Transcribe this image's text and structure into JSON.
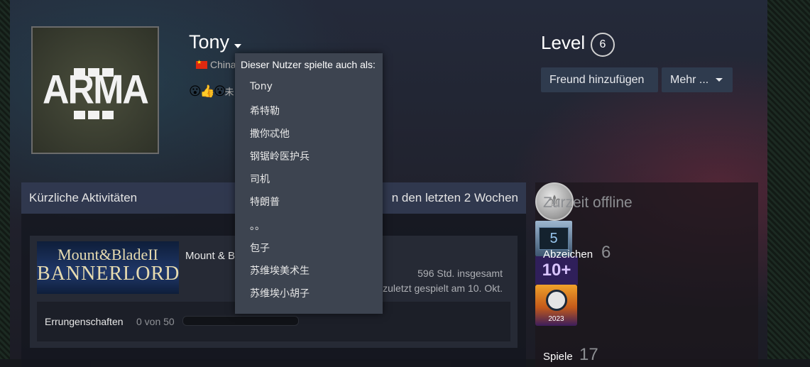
{
  "profile": {
    "persona_name": "Tony",
    "location": "China",
    "avatar_logo_text": "ARMA",
    "emoticon_tail": "未"
  },
  "level": {
    "label": "Level",
    "value": "6"
  },
  "actions": {
    "add_friend": "Freund hinzufügen",
    "more": "Mehr ..."
  },
  "alias_menu": {
    "header": "Dieser Nutzer spielte auch als:",
    "aliases": [
      "Tony",
      "希特勒",
      "撒你忒他",
      "钢锯岭医护兵",
      "司机",
      "特朗普",
      "。。",
      "包子",
      "苏维埃美术生",
      "苏维埃小胡子"
    ]
  },
  "activity": {
    "title": "Kürzliche Aktivitäten",
    "hours_recent_partial": "n den letzten 2 Wochen",
    "game": {
      "name_partial": "Mount & B",
      "capsule_line1": "Mount&BladeII",
      "capsule_line2": "BANNERLORD",
      "hours_total": "596 Std. insgesamt",
      "last_played_partial": "zuletzt gespielt am 10. Okt.",
      "achievements_label": "Errungenschaften",
      "achievements_count": "0 von 50",
      "achievements_progress": 0
    }
  },
  "sidebar": {
    "status": "Zurzeit offline",
    "badges_label": "Abzeichen",
    "badges_count": "6",
    "badges": [
      {
        "icon": "silver-coin-badge-icon",
        "text": ""
      },
      {
        "icon": "level-5-badge-icon",
        "text": "5"
      },
      {
        "icon": "ten-plus-years-badge-icon",
        "text": "10+"
      },
      {
        "icon": "steam-2023-badge-icon",
        "text": "2023"
      }
    ],
    "games_label": "Spiele",
    "games_count": "17"
  }
}
